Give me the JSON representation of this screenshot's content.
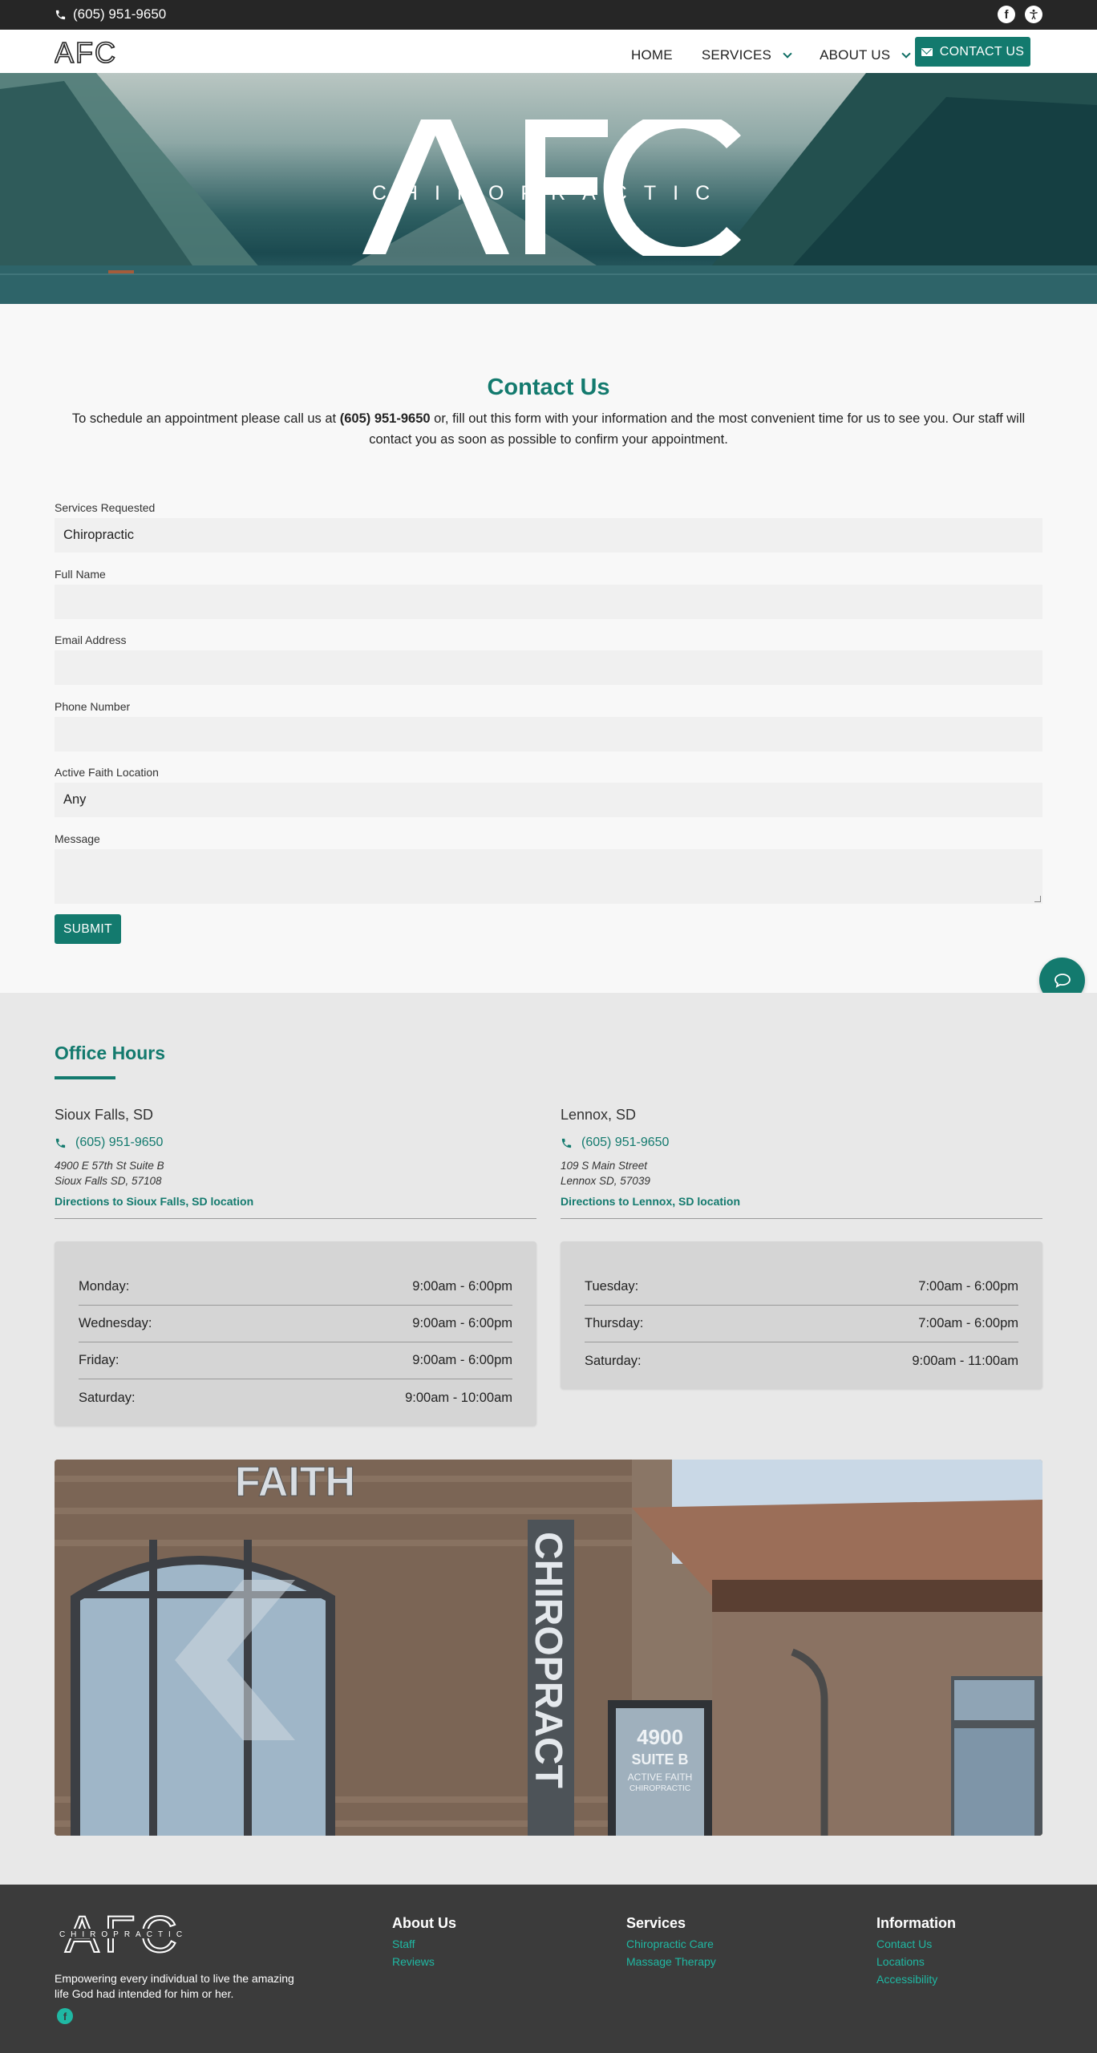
{
  "topbar": {
    "phone": "(605) 951-9650",
    "social_icons": [
      "facebook-icon",
      "accessibility-icon"
    ]
  },
  "nav": {
    "logo_text": "AFC",
    "items": [
      {
        "label": "HOME",
        "has_dropdown": false
      },
      {
        "label": "SERVICES",
        "has_dropdown": true
      },
      {
        "label": "ABOUT US",
        "has_dropdown": true
      }
    ],
    "cta_label": "CONTACT US"
  },
  "hero": {
    "brand_letters": "AFC",
    "brand_word": "CHIROPRACTIC"
  },
  "contact": {
    "title": "Contact Us",
    "intro_before": "To schedule an appointment please call us at ",
    "intro_phone": "(605) 951-9650",
    "intro_after": " or, fill out this form with your information and the most convenient time for us to see you. Our staff will contact you as soon as possible to confirm your appointment.",
    "fields": {
      "services": {
        "label": "Services Requested",
        "value": "Chiropractic"
      },
      "name": {
        "label": "Full Name",
        "value": ""
      },
      "email": {
        "label": "Email Address",
        "value": ""
      },
      "phone": {
        "label": "Phone Number",
        "value": ""
      },
      "location": {
        "label": "Active Faith Location",
        "value": "Any"
      },
      "message": {
        "label": "Message",
        "value": ""
      }
    },
    "submit_label": "SUBMIT"
  },
  "hours": {
    "title": "Office Hours",
    "locations": [
      {
        "city": "Sioux Falls, SD",
        "phone": "(605) 951-9650",
        "address_line1": "4900 E 57th St Suite B",
        "address_line2": "Sioux Falls SD, 57108",
        "directions": "Directions to Sioux Falls, SD location",
        "schedule": [
          {
            "day": "Monday:",
            "time": "9:00am - 6:00pm"
          },
          {
            "day": "Wednesday:",
            "time": "9:00am - 6:00pm"
          },
          {
            "day": "Friday:",
            "time": "9:00am - 6:00pm"
          },
          {
            "day": "Saturday:",
            "time": "9:00am - 10:00am"
          }
        ]
      },
      {
        "city": "Lennox, SD",
        "phone": "(605) 951-9650",
        "address_line1": "109 S Main Street",
        "address_line2": "Lennox SD, 57039",
        "directions": "Directions to Lennox, SD location",
        "schedule": [
          {
            "day": "Tuesday:",
            "time": "7:00am - 6:00pm"
          },
          {
            "day": "Thursday:",
            "time": "7:00am - 6:00pm"
          },
          {
            "day": "Saturday:",
            "time": "9:00am - 11:00am"
          }
        ]
      }
    ],
    "photo": {
      "sign_faith": "FAITH",
      "sign_vertical": "CHIROPRACT",
      "door_number": "4900",
      "door_suite": "SUITE B",
      "door_sign_line1": "ACTIVE FAITH",
      "door_sign_line2": "CHIROPRACTIC"
    }
  },
  "footer": {
    "logo_text": "AFC",
    "logo_word": "CHIROPRACTIC",
    "tagline": "Empowering every individual to live the amazing life God had intended for him or her.",
    "columns": [
      {
        "title": "About Us",
        "links": [
          "Staff",
          "Reviews"
        ]
      },
      {
        "title": "Services",
        "links": [
          "Chiropractic Care",
          "Massage Therapy"
        ]
      },
      {
        "title": "Information",
        "links": [
          "Contact Us",
          "Locations",
          "Accessibility"
        ]
      }
    ]
  },
  "colors": {
    "brand": "#137a6e",
    "link_light": "#1fb8a3",
    "topbar": "#262626",
    "footer": "#3b3b3b"
  }
}
